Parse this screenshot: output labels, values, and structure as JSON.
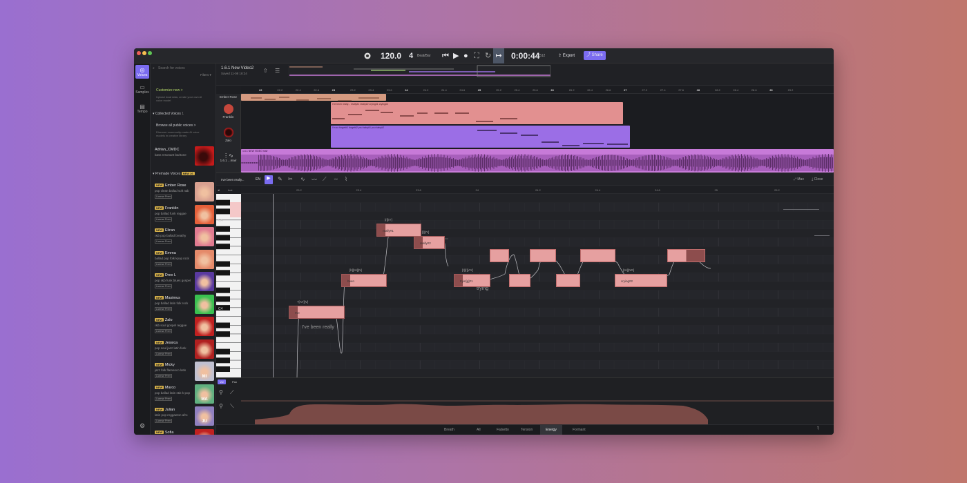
{
  "transport": {
    "tempo": "120.0",
    "beats": "4",
    "beats_unit": "Beat/Bar",
    "time": "0:00:44",
    "time_frac": "512",
    "export": "Export",
    "share": "Share"
  },
  "sidebar": {
    "voices": "Voices",
    "samples": "Samples",
    "tempo": "Tempo"
  },
  "panel": {
    "search_placeholder": "Search for voices",
    "filters": "Filters ▾",
    "customize": "Customize now >",
    "customize_desc": "Upload local data, create your own AI voice model",
    "collected_title": "Collected Voices",
    "collected_count": "1",
    "browse": "Browse all public voices >",
    "browse_desc": "Discover community-made AI voice models in creative library",
    "collected_item": {
      "name": "Adrian_CMDC",
      "desc": "bass resonant baritone"
    },
    "premade_title": "Premade Voices",
    "premade_badge": "NEW 26",
    "new_label": "NEW",
    "license": "License Prem",
    "voices": [
      {
        "name": "Ember Rose",
        "desc": "pop clean ballad soft r&b"
      },
      {
        "name": "Franklin",
        "desc": "pop ballad funk reggae"
      },
      {
        "name": "Eliran",
        "desc": "r&b pop ballad breathy"
      },
      {
        "name": "Emma",
        "desc": "ballad pop folk kpop rock"
      },
      {
        "name": "Drex L",
        "desc": "pop r&b funk blues gospel"
      },
      {
        "name": "Maximus",
        "desc": "pop ballad latin folk rock"
      },
      {
        "name": "Zalo",
        "desc": "r&b soul gospel reggae"
      },
      {
        "name": "Jessica",
        "desc": "pop soul jazz latin funk"
      },
      {
        "name": "Micky",
        "desc": "jazz folk flamenco latin"
      },
      {
        "name": "Marco",
        "desc": "pop ballad latin r&b k-pop"
      },
      {
        "name": "Julian",
        "desc": "latin pop reggaeton afro"
      },
      {
        "name": "Sofia",
        "desc": ""
      }
    ],
    "avatar_initials": {
      "micky": "MI",
      "marco": "MA",
      "julian": "JU"
    }
  },
  "project": {
    "title": "1.6.1 New Video2",
    "subtitle": "Saved 11-08 18:24"
  },
  "tracks": {
    "ember": "Ember Rose",
    "franklin": "Franklin",
    "zalo": "Zalo",
    "audio": "1.6.1 ...mair",
    "franklin_clip": "I've been really... really#1 really#2 crying#1 crying#2",
    "zalo_clip": "I'm so forget#1 forget#2 you baby#1 you baby#2",
    "audio_clip": "1.6.1 NEW VIDEO mair"
  },
  "ruler": [
    "22",
    "22.2",
    "22.4",
    "22.6",
    "23",
    "23.2",
    "23.4",
    "23.6",
    "24",
    "24.2",
    "24.4",
    "24.6",
    "25",
    "25.2",
    "25.4",
    "25.6",
    "26",
    "26.2",
    "26.4",
    "26.6",
    "27",
    "27.2",
    "27.4",
    "27.6",
    "28",
    "28.2",
    "28.4",
    "28.6",
    "29",
    "29.2"
  ],
  "editor": {
    "clip_name": "I've been really...",
    "lang": "EN",
    "max": "Max",
    "close": "Close",
    "inst": "Inst",
    "g4": "G4",
    "c4": "C4",
    "ruler": [
      "23.2",
      "23.4",
      "23.6",
      "24",
      "24.2",
      "24.4",
      "24.6",
      "25",
      "25.2"
    ],
    "phrase1": "I've been really",
    "phrase2": "trying"
  },
  "notes": [
    {
      "text": "I've",
      "phon": "?[AY][V]"
    },
    {
      "text": "been",
      "phon": "[b][IH][N]"
    },
    {
      "text": "really#1",
      "phon": "[r][IY]"
    },
    {
      "text": "really#2",
      "phon": "[l][IY]"
    },
    {
      "text": "tryin[g]#1",
      "phon": "[t][r][AY]"
    },
    {
      "text": "crying#2",
      "phon": "[IH][NG]"
    }
  ],
  "param": {
    "vol": "Vol",
    "pan": "Pan"
  },
  "bottom_tabs": [
    "Breath",
    "All",
    "Falsetto",
    "Tension",
    "Energy",
    "Formant"
  ],
  "colors": {
    "accent": "#7b6cf0",
    "ember": "#d59a80",
    "franklin": "#e29090",
    "zalo": "#9b6ee6",
    "audio": "#c77ad8"
  }
}
